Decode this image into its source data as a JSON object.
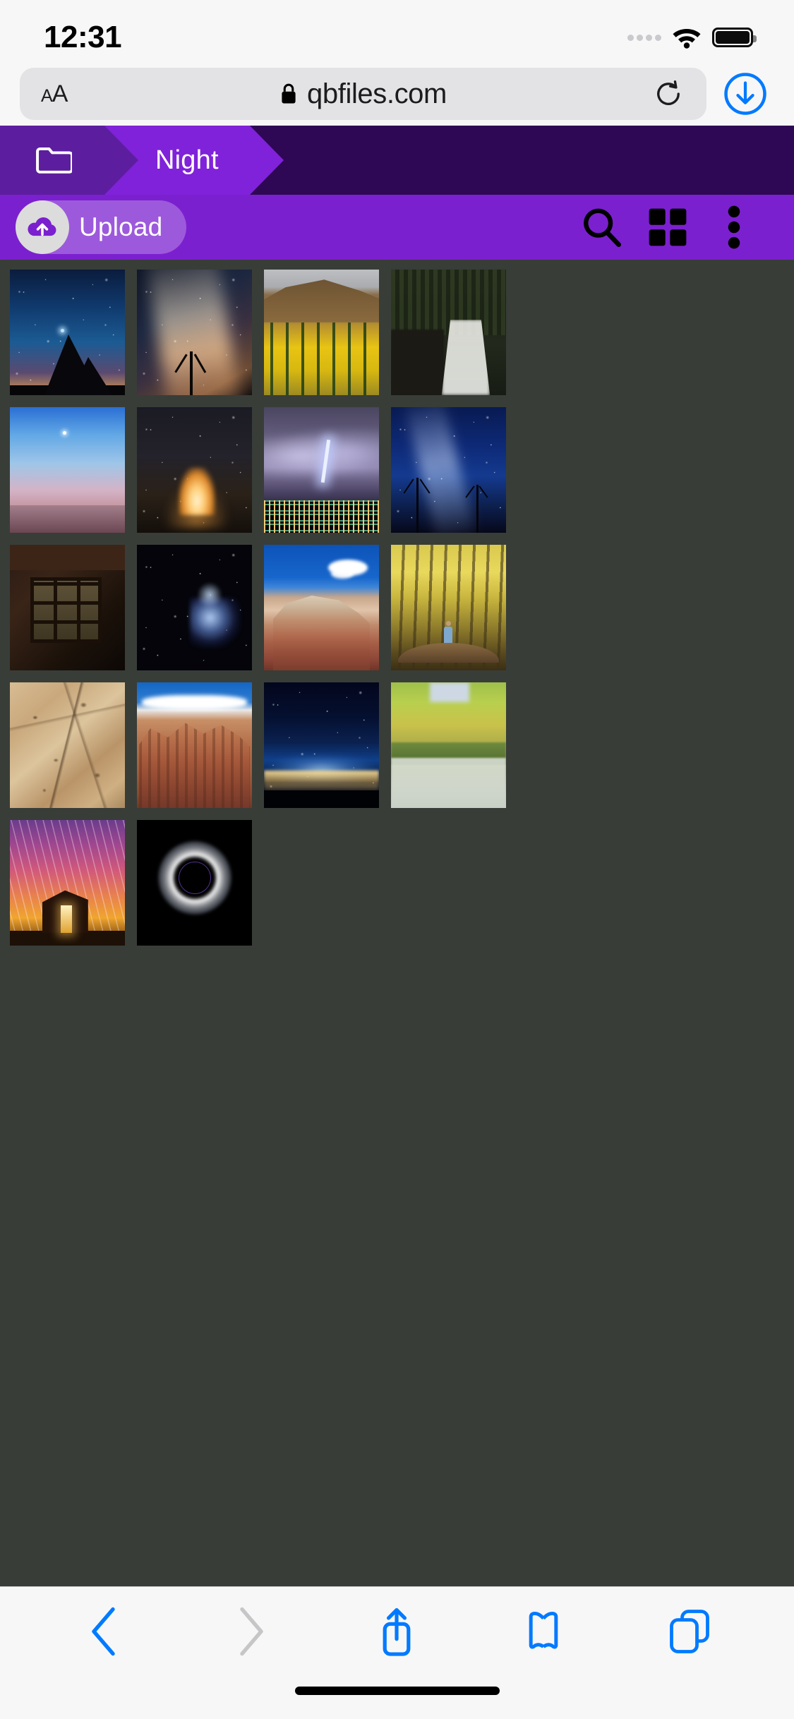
{
  "status_bar": {
    "time": "12:31",
    "signal_icon": "signal-dots-icon",
    "wifi_icon": "wifi-icon",
    "battery_icon": "battery-full-icon"
  },
  "browser": {
    "text_size_label": "AA",
    "lock_icon": "lock-icon",
    "url": "qbfiles.com",
    "reload_icon": "reload-icon",
    "download_icon": "download-circle-icon",
    "bottom_toolbar": [
      {
        "name": "back-button",
        "icon": "chevron-left-icon",
        "enabled": true,
        "color": "#007aff"
      },
      {
        "name": "forward-button",
        "icon": "chevron-right-icon",
        "enabled": false,
        "color": "#c6c6c8"
      },
      {
        "name": "share-button",
        "icon": "share-icon",
        "enabled": true,
        "color": "#007aff"
      },
      {
        "name": "bookmarks-button",
        "icon": "book-icon",
        "enabled": true,
        "color": "#007aff"
      },
      {
        "name": "tabs-button",
        "icon": "tabs-icon",
        "enabled": true,
        "color": "#007aff"
      }
    ]
  },
  "app": {
    "accent_color": "#7b20cf",
    "breadcrumb": {
      "root_icon": "folder-icon",
      "root_color": "#5c1e9e",
      "current_color": "#8022d9",
      "background_color": "#2e0854",
      "items": [
        {
          "label": "",
          "icon": "folder-icon"
        },
        {
          "label": "Night",
          "icon": ""
        }
      ]
    },
    "toolbar": {
      "upload_label": "Upload",
      "upload_icon": "cloud-upload-icon",
      "search_icon": "search-icon",
      "grid_view_icon": "grid-view-icon",
      "more_icon": "more-vertical-icon"
    },
    "grid": {
      "background_color": "#383d38",
      "columns": 4,
      "total_items": 18,
      "rows": [
        [
          {
            "name": "photo-thumbnail",
            "alt": "Starry night sky over rock spire",
            "art": "a1"
          },
          {
            "name": "photo-thumbnail",
            "alt": "Milky way core over bare tree",
            "art": "a2"
          },
          {
            "name": "photo-thumbnail",
            "alt": "Golden aspen forest hillside",
            "art": "a3"
          },
          {
            "name": "photo-thumbnail",
            "alt": "Waterfall in dark forest",
            "art": "a4"
          }
        ],
        [
          {
            "name": "photo-thumbnail",
            "alt": "Blue dusk sky over desert mesa",
            "art": "a5"
          },
          {
            "name": "photo-thumbnail",
            "alt": "Campfire glow at night",
            "art": "a6"
          },
          {
            "name": "photo-thumbnail",
            "alt": "Lightning storm over city lights",
            "art": "a7"
          },
          {
            "name": "photo-thumbnail",
            "alt": "Milky way over bare trees",
            "art": "a8"
          }
        ],
        [
          {
            "name": "photo-thumbnail",
            "alt": "Old barn window interior",
            "art": "a9"
          },
          {
            "name": "photo-thumbnail",
            "alt": "Orion nebula starfield",
            "art": "a10"
          },
          {
            "name": "photo-thumbnail",
            "alt": "Striped red rock mesa under blue sky",
            "art": "a11"
          },
          {
            "name": "photo-thumbnail",
            "alt": "Person on bridge in autumn forest",
            "art": "a12"
          }
        ],
        [
          {
            "name": "photo-thumbnail",
            "alt": "Eroded sandstone texture",
            "art": "a13"
          },
          {
            "name": "photo-thumbnail",
            "alt": "Red rock cliffs under blue sky",
            "art": "a14"
          },
          {
            "name": "photo-thumbnail",
            "alt": "City glow under night sky",
            "art": "a15"
          },
          {
            "name": "photo-thumbnail",
            "alt": "Autumn creek with golden trees",
            "art": "a16"
          }
        ],
        [
          {
            "name": "photo-thumbnail",
            "alt": "Star trails over cabin",
            "art": "a17"
          },
          {
            "name": "photo-thumbnail",
            "alt": "Total solar eclipse corona",
            "art": "a18"
          }
        ]
      ]
    }
  }
}
